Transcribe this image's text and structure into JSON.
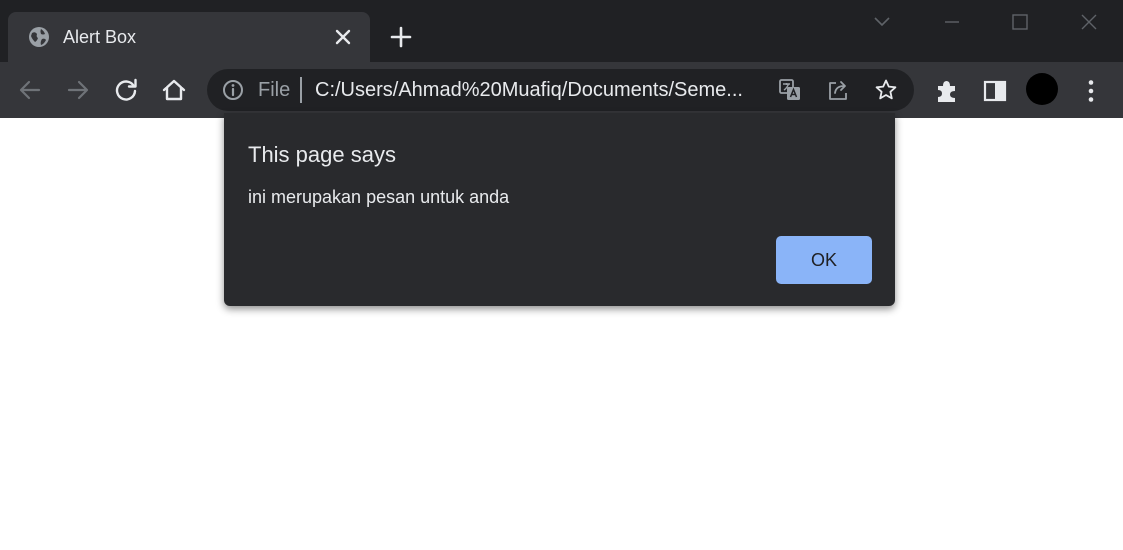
{
  "tab": {
    "title": "Alert Box",
    "favicon": "globe-icon",
    "close_icon": "close-icon"
  },
  "toolbar": {
    "back_icon": "back-arrow-icon",
    "forward_icon": "forward-arrow-icon",
    "reload_icon": "reload-icon",
    "home_icon": "home-icon"
  },
  "omnibox": {
    "scheme": "File",
    "url": "C:/Users/Ahmad%20Muafiq/Documents/Seme..."
  },
  "dialog": {
    "title": "This page says",
    "message": "ini merupakan pesan untuk anda",
    "ok_label": "OK"
  },
  "colors": {
    "tabstrip": "#202124",
    "toolbar": "#35363a",
    "dialog_bg": "#292a2d",
    "ok_button": "#8ab4f8",
    "page_bg": "#ffffff"
  }
}
